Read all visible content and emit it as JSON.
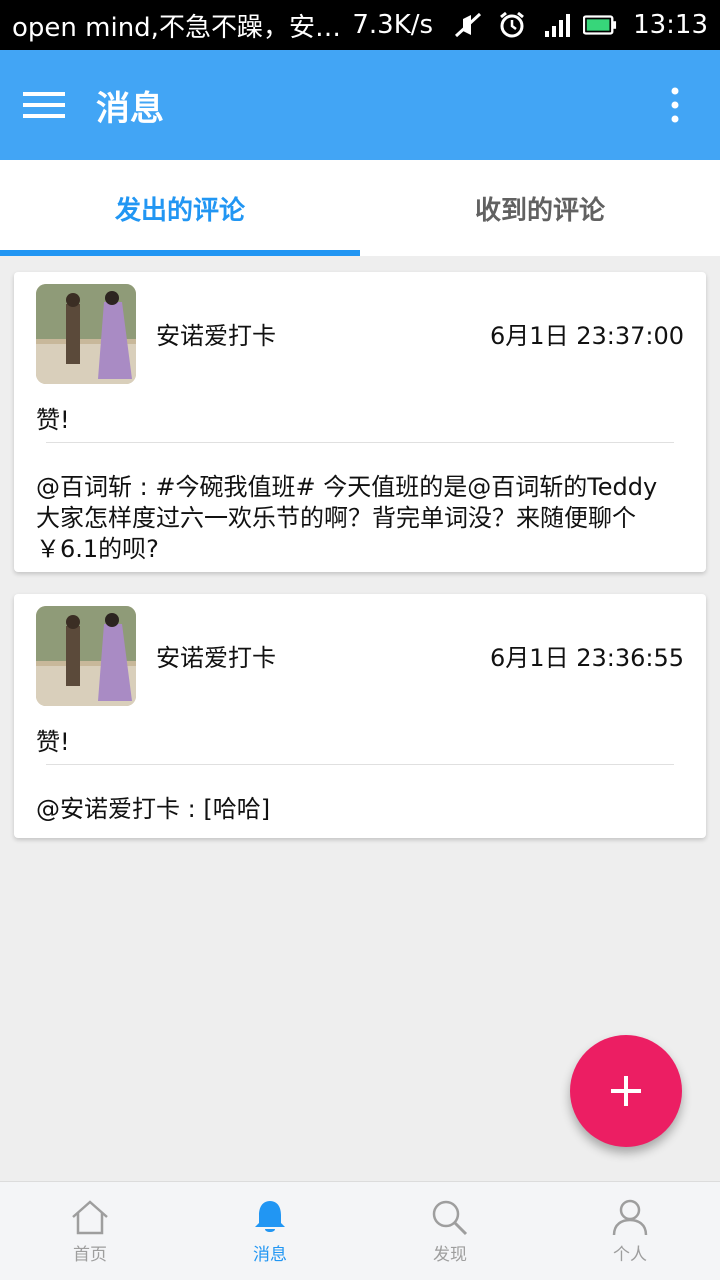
{
  "status_bar": {
    "notification": "open mind,不急不躁，安…",
    "speed": "7.3K/s",
    "time": "13:13",
    "icons": [
      "mute-icon",
      "alarm-icon",
      "signal-icon",
      "battery-icon"
    ]
  },
  "app_bar": {
    "title": "消息",
    "menu_icon": "hamburger-menu-icon",
    "more_icon": "more-vertical-icon",
    "color": "#42a5f5"
  },
  "tabs": [
    {
      "label": "发出的评论",
      "active": true
    },
    {
      "label": "收到的评论",
      "active": false
    }
  ],
  "comments": [
    {
      "name": "安诺爱打卡",
      "time": "6月1日 23:37:00",
      "comment": "赞!",
      "quote": "@百词斩 : #今碗我值班# 今天值班的是@百词斩的Teddy 大家怎样度过六一欢乐节的啊？背完单词没？来随便聊个￥6.1的呗?"
    },
    {
      "name": "安诺爱打卡",
      "time": "6月1日 23:36:55",
      "comment": "赞!",
      "quote": "@安诺爱打卡 : [哈哈]"
    }
  ],
  "fab": {
    "icon": "plus-icon",
    "color": "#ec1e63"
  },
  "bottom_nav": [
    {
      "label": "首页",
      "icon": "home-icon",
      "active": false
    },
    {
      "label": "消息",
      "icon": "bell-icon",
      "active": true
    },
    {
      "label": "发现",
      "icon": "search-icon",
      "active": false
    },
    {
      "label": "个人",
      "icon": "person-icon",
      "active": false
    }
  ],
  "accent_color": "#2196f3"
}
